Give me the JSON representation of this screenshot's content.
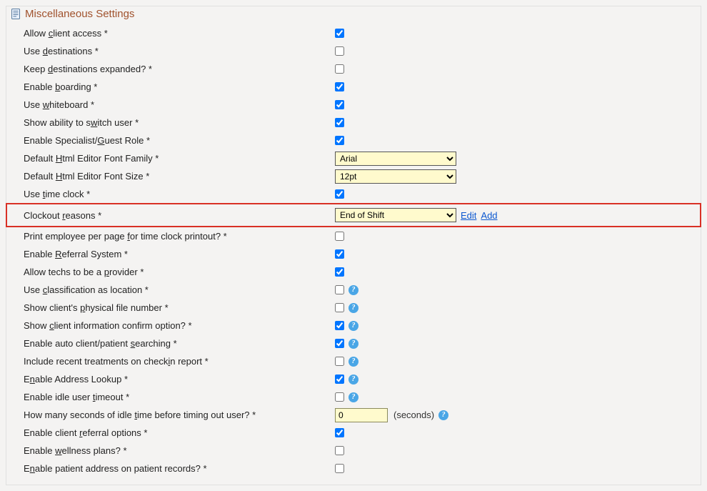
{
  "panel": {
    "title": "Miscellaneous Settings"
  },
  "rows": [
    {
      "pre": "Allow ",
      "u": "c",
      "post": "lient access *",
      "type": "checkbox",
      "checked": true
    },
    {
      "pre": "Use ",
      "u": "d",
      "post": "estinations *",
      "type": "checkbox",
      "checked": false
    },
    {
      "pre": "Keep ",
      "u": "d",
      "post": "estinations expanded? *",
      "type": "checkbox",
      "checked": false
    },
    {
      "pre": "Enable ",
      "u": "b",
      "post": "oarding *",
      "type": "checkbox",
      "checked": true
    },
    {
      "pre": "Use ",
      "u": "w",
      "post": "hiteboard *",
      "type": "checkbox",
      "checked": true
    },
    {
      "pre": "Show ability to s",
      "u": "w",
      "post": "itch user *",
      "type": "checkbox",
      "checked": true
    },
    {
      "pre": "Enable Specialist/",
      "u": "G",
      "post": "uest Role *",
      "type": "checkbox",
      "checked": true
    },
    {
      "pre": "Default ",
      "u": "H",
      "post": "tml Editor Font Family *",
      "type": "select",
      "value": "Arial"
    },
    {
      "pre": "Default ",
      "u": "H",
      "post": "tml Editor Font Size *",
      "type": "select",
      "value": "12pt"
    },
    {
      "pre": "Use ",
      "u": "t",
      "post": "ime clock *",
      "type": "checkbox",
      "checked": true
    },
    {
      "pre": "Clockout ",
      "u": "r",
      "post": "easons *",
      "type": "select",
      "value": "End of Shift",
      "links": [
        "Edit",
        "Add"
      ],
      "highlighted": true
    },
    {
      "pre": "Print employee per page ",
      "u": "f",
      "post": "or time clock printout? *",
      "type": "checkbox",
      "checked": false
    },
    {
      "pre": "Enable ",
      "u": "R",
      "post": "eferral System *",
      "type": "checkbox",
      "checked": true
    },
    {
      "pre": "Allow techs to be a ",
      "u": "p",
      "post": "rovider *",
      "type": "checkbox",
      "checked": true
    },
    {
      "pre": "Use ",
      "u": "c",
      "post": "lassification as location *",
      "type": "checkbox",
      "checked": false,
      "help": true
    },
    {
      "pre": "Show client's ",
      "u": "p",
      "post": "hysical file number *",
      "type": "checkbox",
      "checked": false,
      "help": true
    },
    {
      "pre": "Show ",
      "u": "c",
      "post": "lient information confirm option? *",
      "type": "checkbox",
      "checked": true,
      "help": true
    },
    {
      "pre": "Enable auto client/patient ",
      "u": "s",
      "post": "earching *",
      "type": "checkbox",
      "checked": true,
      "help": true
    },
    {
      "pre": "Include recent treatments on check",
      "u": "i",
      "post": "n report *",
      "type": "checkbox",
      "checked": false,
      "help": true
    },
    {
      "pre": "E",
      "u": "n",
      "post": "able Address Lookup *",
      "type": "checkbox",
      "checked": true,
      "help": true
    },
    {
      "pre": "Enable idle user ",
      "u": "t",
      "post": "imeout *",
      "type": "checkbox",
      "checked": false,
      "help": true
    },
    {
      "pre": "How many seconds of idle ",
      "u": "t",
      "post": "ime before timing out user? *",
      "type": "number",
      "value": "0",
      "after": "(seconds)",
      "help": true
    },
    {
      "pre": "Enable client ",
      "u": "r",
      "post": "eferral options *",
      "type": "checkbox",
      "checked": true
    },
    {
      "pre": "Enable ",
      "u": "w",
      "post": "ellness plans? *",
      "type": "checkbox",
      "checked": false
    },
    {
      "pre": "E",
      "u": "n",
      "post": "able patient address on patient records? *",
      "type": "checkbox",
      "checked": false
    }
  ]
}
